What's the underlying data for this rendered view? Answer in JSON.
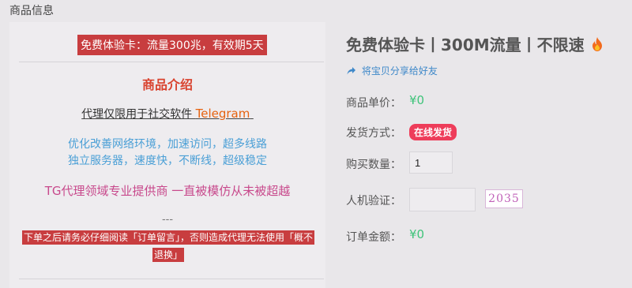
{
  "section_title": "商品信息",
  "left": {
    "notice": "免费体验卡：流量300兆，有效期5天",
    "intro_title": "商品介绍",
    "proxy_text": "代理仅限用于社交软件 ",
    "proxy_app": "Telegram",
    "features_1": "优化改善网络环境，加速访问，超多线路",
    "features_2": "独立服务器，速度快，不断线，超级稳定",
    "tagline": "TG代理领域专业提供商 一直被模仿从未被超越",
    "separator": "---",
    "warning_1": "下单之后请务必仔细阅读「订单留言」，否则造成代理无法使用「概不",
    "warning_2": "退换」"
  },
  "right": {
    "product_title": "免费体验卡丨300M流量丨不限速",
    "title_icon": "fire-icon",
    "share_link": "将宝贝分享给好友",
    "share_icon": "share-icon",
    "unit_price_label": "商品单价：",
    "unit_price": "¥0",
    "delivery_label": "发货方式：",
    "delivery_badge": "在线发货",
    "quantity_label": "购买数量：",
    "quantity_value": "1",
    "captcha_label": "人机验证：",
    "captcha_placeholder": "",
    "captcha_code": "2035",
    "total_label": "订单金额：",
    "total_value": "¥0"
  },
  "colors": {
    "background": "#e9e7ea",
    "notice_bg": "#c83d3f",
    "intro_title": "#d9432f",
    "proxy_app": "#e6620f",
    "features": "#4a9fd6",
    "tagline": "#c8498c",
    "price": "#3fc37a",
    "badge": "#ee3d5a",
    "share_link": "#3e88c9"
  }
}
